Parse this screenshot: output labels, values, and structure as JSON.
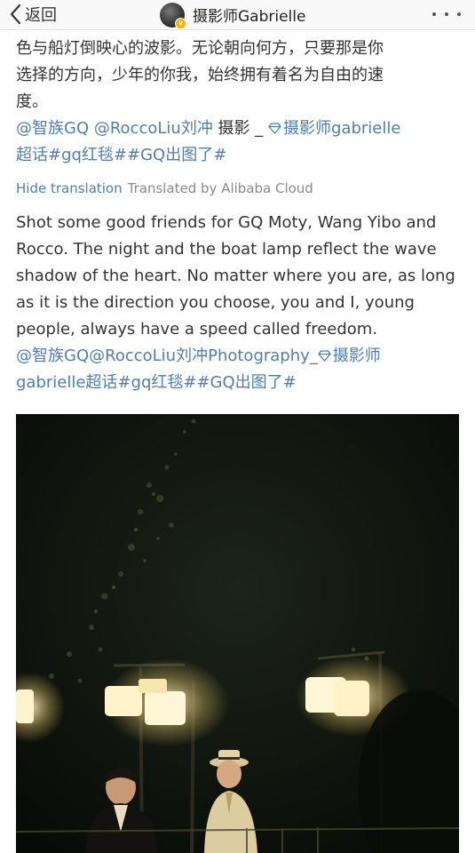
{
  "nav": {
    "back_label": "返回",
    "title": "摄影师Gabrielle"
  },
  "post": {
    "cn_line1": "色与船灯倒映心的波影。无论朝向何方，只要那是你",
    "cn_line2": "选择的方向，少年的你我，始终拥有着名为自由的速",
    "cn_line3": "度。",
    "cn_mention1": "@智族GQ",
    "cn_mention2": "@RoccoLiu刘冲",
    "cn_text_photo": " 摄影 _ ",
    "cn_supertopic": "摄影师gabrielle",
    "cn_supertopic_suffix": "超话",
    "cn_hashtag1": "#gq红毯#",
    "cn_hashtag2": "#GQ出图了#",
    "hide_translation": "Hide translation",
    "translated_by": "Translated by Alibaba Cloud",
    "en_text": "Shot some good friends for GQ Moty, Wang Yibo and Rocco. The night and the boat lamp reflect the wave shadow of the heart. No matter where you are, as long as it is the direction you choose, you and I, young people, always have a speed called freedom. ",
    "en_mention1": "@智族GQ",
    "en_mention2": "@RoccoLiu刘冲",
    "en_photo": "Photography_",
    "en_supertopic_line1": "摄影师",
    "en_supertopic_line2": "gabrielle超话",
    "en_hashtag1": "#gq红毯#",
    "en_hashtag2": "#GQ出图了#"
  },
  "icons": {
    "back": "chevron-left-icon",
    "more": "more-dots-icon",
    "supertopic": "diamond-icon",
    "verified": "verified-badge-icon"
  },
  "colors": {
    "link": "#507daf",
    "text": "#333333",
    "meta": "#8a8a8a",
    "navbar_bg": "#f9f9f9",
    "verified": "#ffb400"
  }
}
